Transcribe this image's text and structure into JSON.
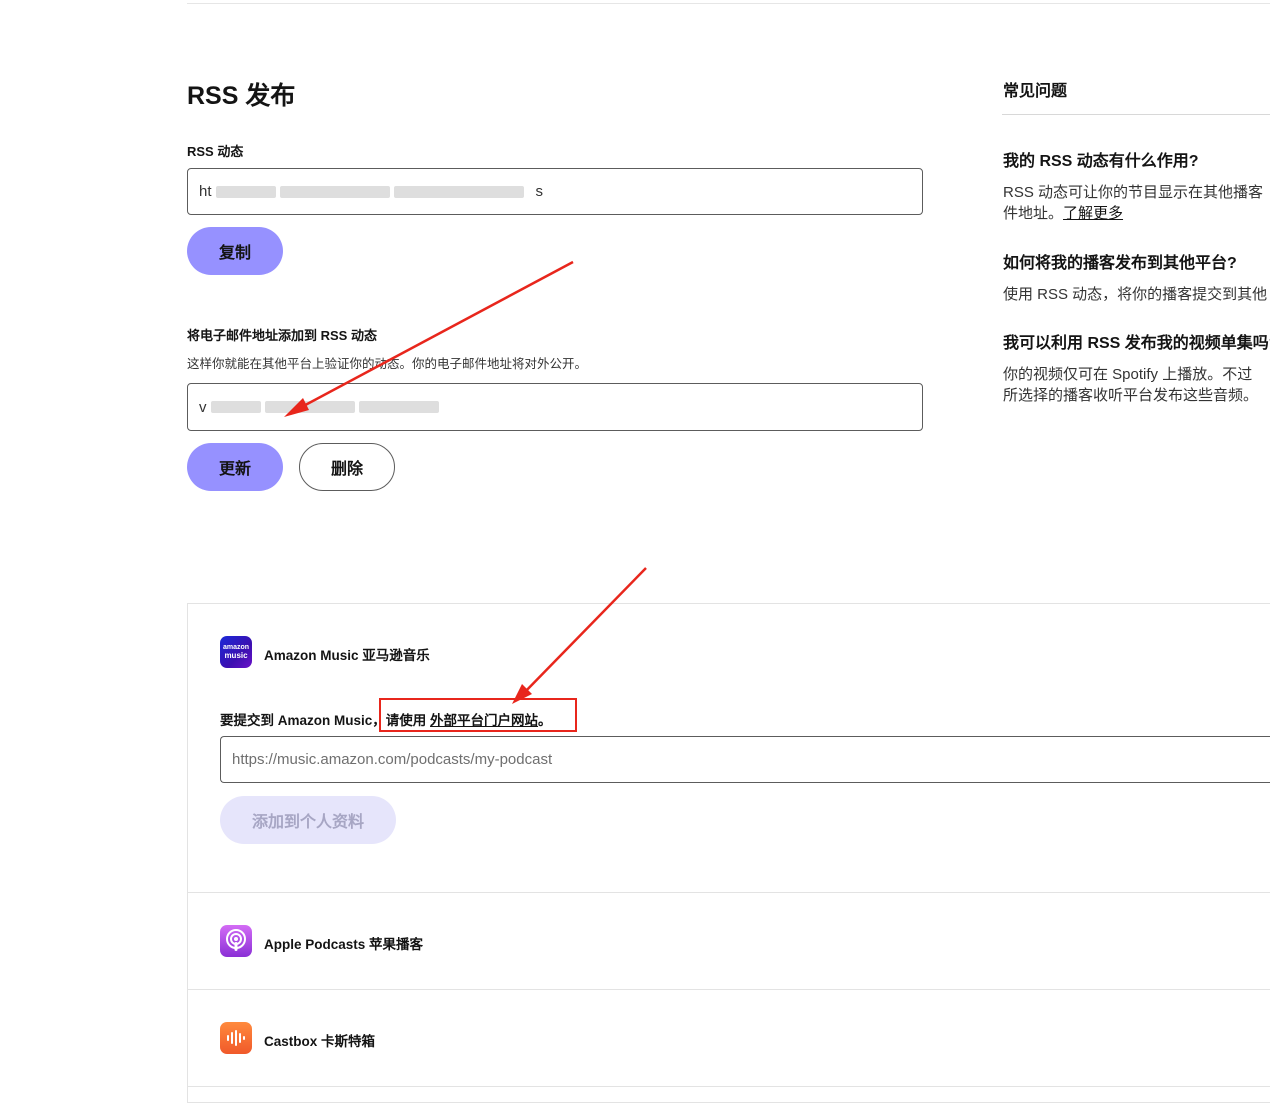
{
  "rss": {
    "title": "RSS 发布",
    "feed_label": "RSS 动态",
    "feed_url_start": "ht",
    "feed_url_end": "s",
    "copy_button": "复制",
    "email_label": "将电子邮件地址添加到 RSS 动态",
    "email_desc": "这样你就能在其他平台上验证你的动态。你的电子邮件地址将对外公开。",
    "email_value_start": "v",
    "update_button": "更新",
    "delete_button": "删除"
  },
  "faq": {
    "heading": "常见问题",
    "q1": "我的 RSS 动态有什么作用?",
    "a1_line1": "RSS 动态可让你的节目显示在其他播客",
    "a1_line2": "件地址。",
    "a1_link": "了解更多",
    "q2": "如何将我的播客发布到其他平台?",
    "a2": "使用 RSS 动态，将你的播客提交到其他",
    "q3": "我可以利用 RSS 发布我的视频单集吗?",
    "a3_line1": "你的视频仅可在 Spotify 上播放。不过",
    "a3_line2": "所选择的播客收听平台发布这些音频。"
  },
  "platforms": {
    "amazon": {
      "name": "Amazon Music 亚马逊音乐",
      "icon_text_top": "amazon",
      "icon_text_bottom": "music",
      "submit_prefix": "要提交到 Amazon Music，",
      "submit_mid": "请使用",
      "submit_link": "外部平台门户网站",
      "submit_end": "。",
      "url_placeholder": "https://music.amazon.com/podcasts/my-podcast",
      "add_button": "添加到个人资料"
    },
    "apple": {
      "name": "Apple Podcasts 苹果播客"
    },
    "castbox": {
      "name": "Castbox 卡斯特箱"
    }
  },
  "colors": {
    "primary_button": "#9691ff",
    "disabled_button": "#e6e5fb",
    "annotation_red": "#e8261c",
    "amazon_icon": "#2a1fd1",
    "apple_icon": "#9a3fe0",
    "castbox_icon": "#f26b2d"
  },
  "icons": [
    "amazon-music-icon",
    "apple-podcasts-icon",
    "castbox-icon",
    "annotation-arrow"
  ]
}
